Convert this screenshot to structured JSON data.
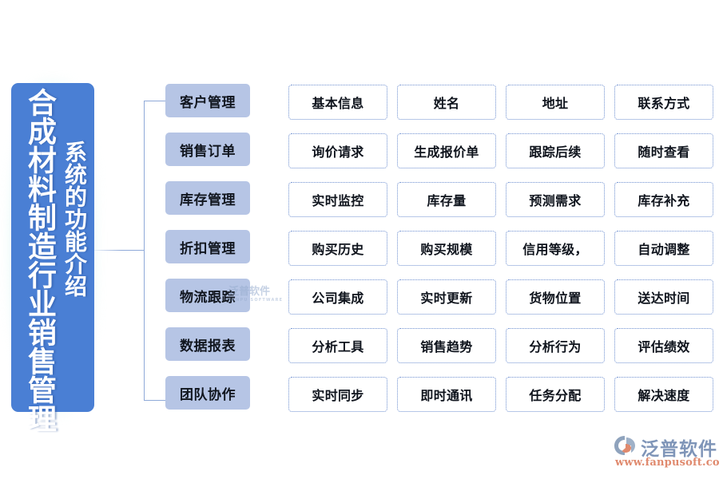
{
  "diagram": {
    "title_block": {
      "main_text": "合成材料制造行业销售管理",
      "sub_text": "系统的功能介绍",
      "background_color": "#4a7fd4",
      "text_color": "#ffffff",
      "glow_color": "#c8f0e8"
    },
    "category_box_color": "#b6c5e5",
    "detail_box_border_color": "#6e8fd0",
    "connector_color": "#8fa9d8",
    "categories": [
      {
        "label": "客户管理"
      },
      {
        "label": "销售订单"
      },
      {
        "label": "库存管理"
      },
      {
        "label": "折扣管理"
      },
      {
        "label": "物流跟踪"
      },
      {
        "label": "数据报表"
      },
      {
        "label": "团队协作"
      }
    ],
    "detail_rows": [
      {
        "category": "客户管理",
        "items": [
          "基本信息",
          "姓名",
          "地址",
          "联系方式"
        ]
      },
      {
        "category": "销售订单",
        "items": [
          "询价请求",
          "生成报价单",
          "跟踪后续",
          "随时查看"
        ]
      },
      {
        "category": "库存管理",
        "items": [
          "实时监控",
          "库存量",
          "预测需求",
          "库存补充"
        ]
      },
      {
        "category": "折扣管理",
        "items": [
          "购买历史",
          "购买规模",
          "信用等级，",
          "自动调整"
        ]
      },
      {
        "category": "物流跟踪",
        "items": [
          "公司集成",
          "实时更新",
          "货物位置",
          "送达时间"
        ]
      },
      {
        "category": "数据报表",
        "items": [
          "分析工具",
          "销售趋势",
          "分析行为",
          "评估绩效"
        ]
      },
      {
        "category": "团队协作",
        "items": [
          "实时同步",
          "即时通讯",
          "任务分配",
          "解决速度"
        ]
      }
    ]
  },
  "watermark": {
    "text": "泛普软件",
    "subtext": "FANPU SOFTWARE"
  },
  "logo": {
    "name": "泛普软件",
    "url": "www.fanpusoft.com",
    "name_color": "#7f95b8",
    "url_color": "#e08a6e"
  }
}
